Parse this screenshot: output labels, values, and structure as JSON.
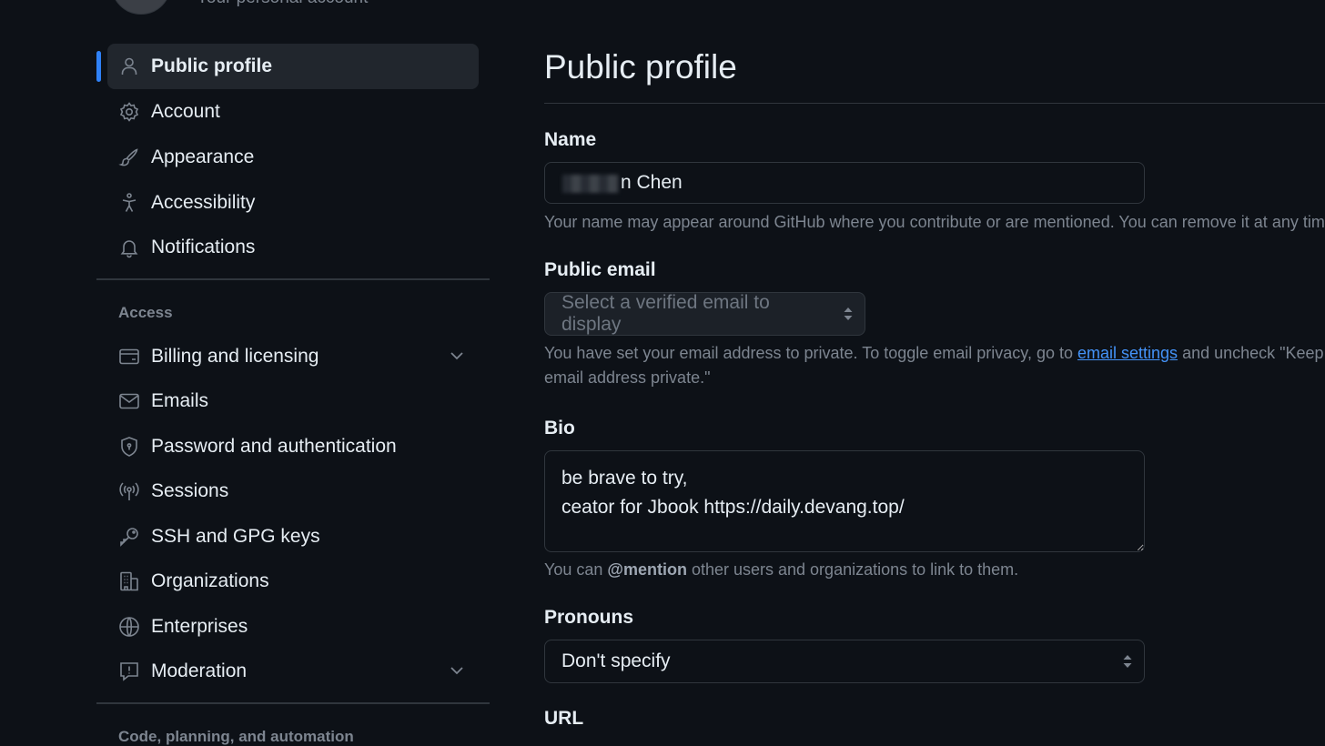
{
  "header": {
    "subtitle": "Your personal account"
  },
  "sidebar": {
    "items": [
      {
        "label": "Public profile",
        "icon": "person-icon",
        "active": true
      },
      {
        "label": "Account",
        "icon": "gear-icon"
      },
      {
        "label": "Appearance",
        "icon": "paintbrush-icon"
      },
      {
        "label": "Accessibility",
        "icon": "accessibility-icon"
      },
      {
        "label": "Notifications",
        "icon": "bell-icon"
      }
    ],
    "access_heading": "Access",
    "access_items": [
      {
        "label": "Billing and licensing",
        "icon": "credit-card-icon",
        "expandable": true
      },
      {
        "label": "Emails",
        "icon": "mail-icon"
      },
      {
        "label": "Password and authentication",
        "icon": "shield-lock-icon"
      },
      {
        "label": "Sessions",
        "icon": "broadcast-icon"
      },
      {
        "label": "SSH and GPG keys",
        "icon": "key-icon"
      },
      {
        "label": "Organizations",
        "icon": "organization-icon"
      },
      {
        "label": "Enterprises",
        "icon": "globe-icon"
      },
      {
        "label": "Moderation",
        "icon": "report-icon",
        "expandable": true
      }
    ],
    "code_heading": "Code, planning, and automation"
  },
  "main": {
    "title": "Public profile",
    "name": {
      "label": "Name",
      "value": "n Chen",
      "help": "Your name may appear around GitHub where you contribute or are mentioned. You can remove it at any time."
    },
    "public_email": {
      "label": "Public email",
      "placeholder": "Select a verified email to display",
      "help_before": "You have set your email address to private. To toggle email privacy, go to ",
      "help_link": "email settings",
      "help_after": " and uncheck \"Keep my",
      "help_line2": "email address private.\""
    },
    "bio": {
      "label": "Bio",
      "value": "be brave to try,\nceator for Jbook https://daily.devang.top/",
      "help_before": "You can ",
      "help_mention": "@mention",
      "help_after": " other users and organizations to link to them."
    },
    "pronouns": {
      "label": "Pronouns",
      "selected": "Don't specify"
    },
    "url": {
      "label": "URL"
    }
  },
  "colors": {
    "background": "#0d1117",
    "accent": "#2f81f7",
    "link": "#4493f8",
    "muted": "#7d8590",
    "border": "#30363d"
  }
}
